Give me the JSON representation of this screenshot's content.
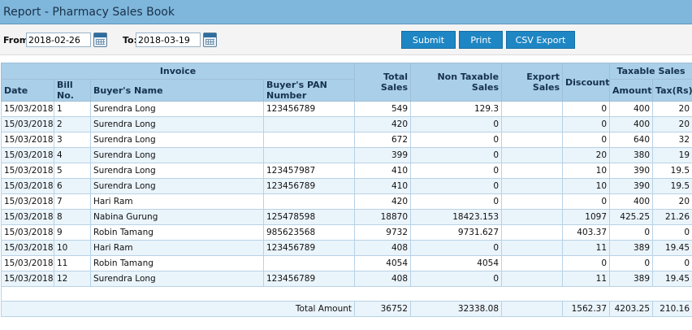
{
  "title": "Report - Pharmacy Sales Book",
  "filters": {
    "from_label": "From:",
    "from_value": "2018-02-26",
    "to_label": "To:",
    "to_value": "2018-03-19"
  },
  "buttons": {
    "submit": "Submit",
    "print": "Print",
    "csv": "CSV Export"
  },
  "headers": {
    "invoice": "Invoice",
    "date": "Date",
    "bill_no": "Bill No.",
    "buyer_name": "Buyer's Name",
    "buyer_pan": "Buyer's PAN Number",
    "total_sales": "Total Sales",
    "non_taxable": "Non Taxable Sales",
    "export_sales": "Export Sales",
    "discount": "Discount",
    "taxable_sales": "Taxable Sales",
    "amount": "Amount",
    "tax": "Tax(Rs)"
  },
  "rows": [
    {
      "date": "15/03/2018",
      "bill": "1",
      "name": "Surendra Long",
      "pan": "123456789",
      "total": "549",
      "nontax": "129.3",
      "export": "",
      "discount": "0",
      "amount": "400",
      "tax": "20"
    },
    {
      "date": "15/03/2018",
      "bill": "2",
      "name": "Surendra Long",
      "pan": "",
      "total": "420",
      "nontax": "0",
      "export": "",
      "discount": "0",
      "amount": "400",
      "tax": "20"
    },
    {
      "date": "15/03/2018",
      "bill": "3",
      "name": "Surendra Long",
      "pan": "",
      "total": "672",
      "nontax": "0",
      "export": "",
      "discount": "0",
      "amount": "640",
      "tax": "32"
    },
    {
      "date": "15/03/2018",
      "bill": "4",
      "name": "Surendra Long",
      "pan": "",
      "total": "399",
      "nontax": "0",
      "export": "",
      "discount": "20",
      "amount": "380",
      "tax": "19"
    },
    {
      "date": "15/03/2018",
      "bill": "5",
      "name": "Surendra Long",
      "pan": "123457987",
      "total": "410",
      "nontax": "0",
      "export": "",
      "discount": "10",
      "amount": "390",
      "tax": "19.5"
    },
    {
      "date": "15/03/2018",
      "bill": "6",
      "name": "Surendra Long",
      "pan": "123456789",
      "total": "410",
      "nontax": "0",
      "export": "",
      "discount": "10",
      "amount": "390",
      "tax": "19.5"
    },
    {
      "date": "15/03/2018",
      "bill": "7",
      "name": "Hari Ram",
      "pan": "",
      "total": "420",
      "nontax": "0",
      "export": "",
      "discount": "0",
      "amount": "400",
      "tax": "20"
    },
    {
      "date": "15/03/2018",
      "bill": "8",
      "name": "Nabina Gurung",
      "pan": "125478598",
      "total": "18870",
      "nontax": "18423.153",
      "export": "",
      "discount": "1097",
      "amount": "425.25",
      "tax": "21.26"
    },
    {
      "date": "15/03/2018",
      "bill": "9",
      "name": "Robin Tamang",
      "pan": "985623568",
      "total": "9732",
      "nontax": "9731.627",
      "export": "",
      "discount": "403.37",
      "amount": "0",
      "tax": "0"
    },
    {
      "date": "15/03/2018",
      "bill": "10",
      "name": "Hari Ram",
      "pan": "123456789",
      "total": "408",
      "nontax": "0",
      "export": "",
      "discount": "11",
      "amount": "389",
      "tax": "19.45"
    },
    {
      "date": "15/03/2018",
      "bill": "11",
      "name": "Robin Tamang",
      "pan": "",
      "total": "4054",
      "nontax": "4054",
      "export": "",
      "discount": "0",
      "amount": "0",
      "tax": "0"
    },
    {
      "date": "15/03/2018",
      "bill": "12",
      "name": "Surendra Long",
      "pan": "123456789",
      "total": "408",
      "nontax": "0",
      "export": "",
      "discount": "11",
      "amount": "389",
      "tax": "19.45"
    }
  ],
  "totals": {
    "label": "Total Amount",
    "total": "36752",
    "nontax": "32338.08",
    "export": "",
    "discount": "1562.37",
    "amount": "4203.25",
    "tax": "210.16"
  }
}
